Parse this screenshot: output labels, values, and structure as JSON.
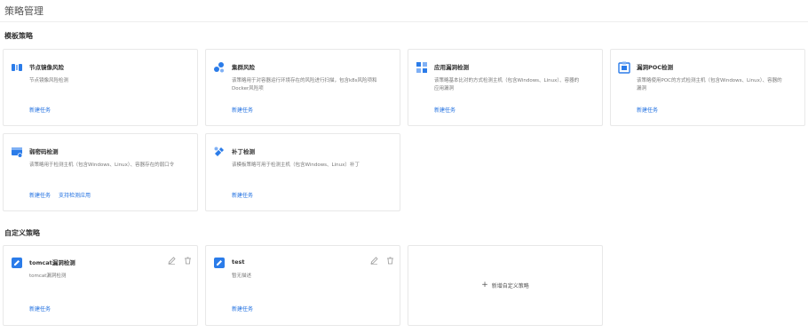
{
  "page": {
    "title": "策略管理"
  },
  "template_section": {
    "title": "模板策略",
    "cards": [
      {
        "icon": "container-image-icon",
        "title": "节点镜像风险",
        "desc": "节点镜像风险检测",
        "links": [
          "新建任务"
        ]
      },
      {
        "icon": "cluster-icon",
        "title": "集群风险",
        "desc": "该策略用于对容器运行环境存在的风险进行扫描，包含k8s风险项和Docker风险项",
        "links": [
          "新建任务"
        ]
      },
      {
        "icon": "app-vuln-icon",
        "title": "应用漏洞检测",
        "desc": "该策略基本比对的方式检测主机（包含Windows、Linux）、容器的应用漏洞",
        "links": [
          "新建任务"
        ]
      },
      {
        "icon": "poc-icon",
        "title": "漏洞POC检测",
        "desc": "该策略使用POC的方式检测主机（包含Windows、Linux）、容器的漏洞",
        "links": [
          "新建任务"
        ]
      },
      {
        "icon": "weak-password-icon",
        "title": "弱密码检测",
        "desc": "该策略用于检测主机（包含Windows、Linux）、容器存在的弱口令",
        "links": [
          "新建任务",
          "支持检测应用"
        ]
      },
      {
        "icon": "patch-icon",
        "title": "补丁检测",
        "desc": "该模板策略可用于检测主机（包含Windows、Linux）补丁",
        "links": [
          "新建任务"
        ]
      }
    ]
  },
  "custom_section": {
    "title": "自定义策略",
    "cards": [
      {
        "icon": "custom-policy-icon",
        "title": "tomcat漏洞检测",
        "desc": "tomcat漏洞检测",
        "links": [
          "新建任务"
        ]
      },
      {
        "icon": "custom-policy-icon",
        "title": "test",
        "desc": "暂无描述",
        "links": [
          "新建任务"
        ]
      }
    ],
    "add_label": "新增自定义策略",
    "add_icon": "plus-icon"
  },
  "colors": {
    "accent": "#1f6fe0",
    "icon_blue": "#2b7ce9",
    "border": "#e8e8e8"
  }
}
